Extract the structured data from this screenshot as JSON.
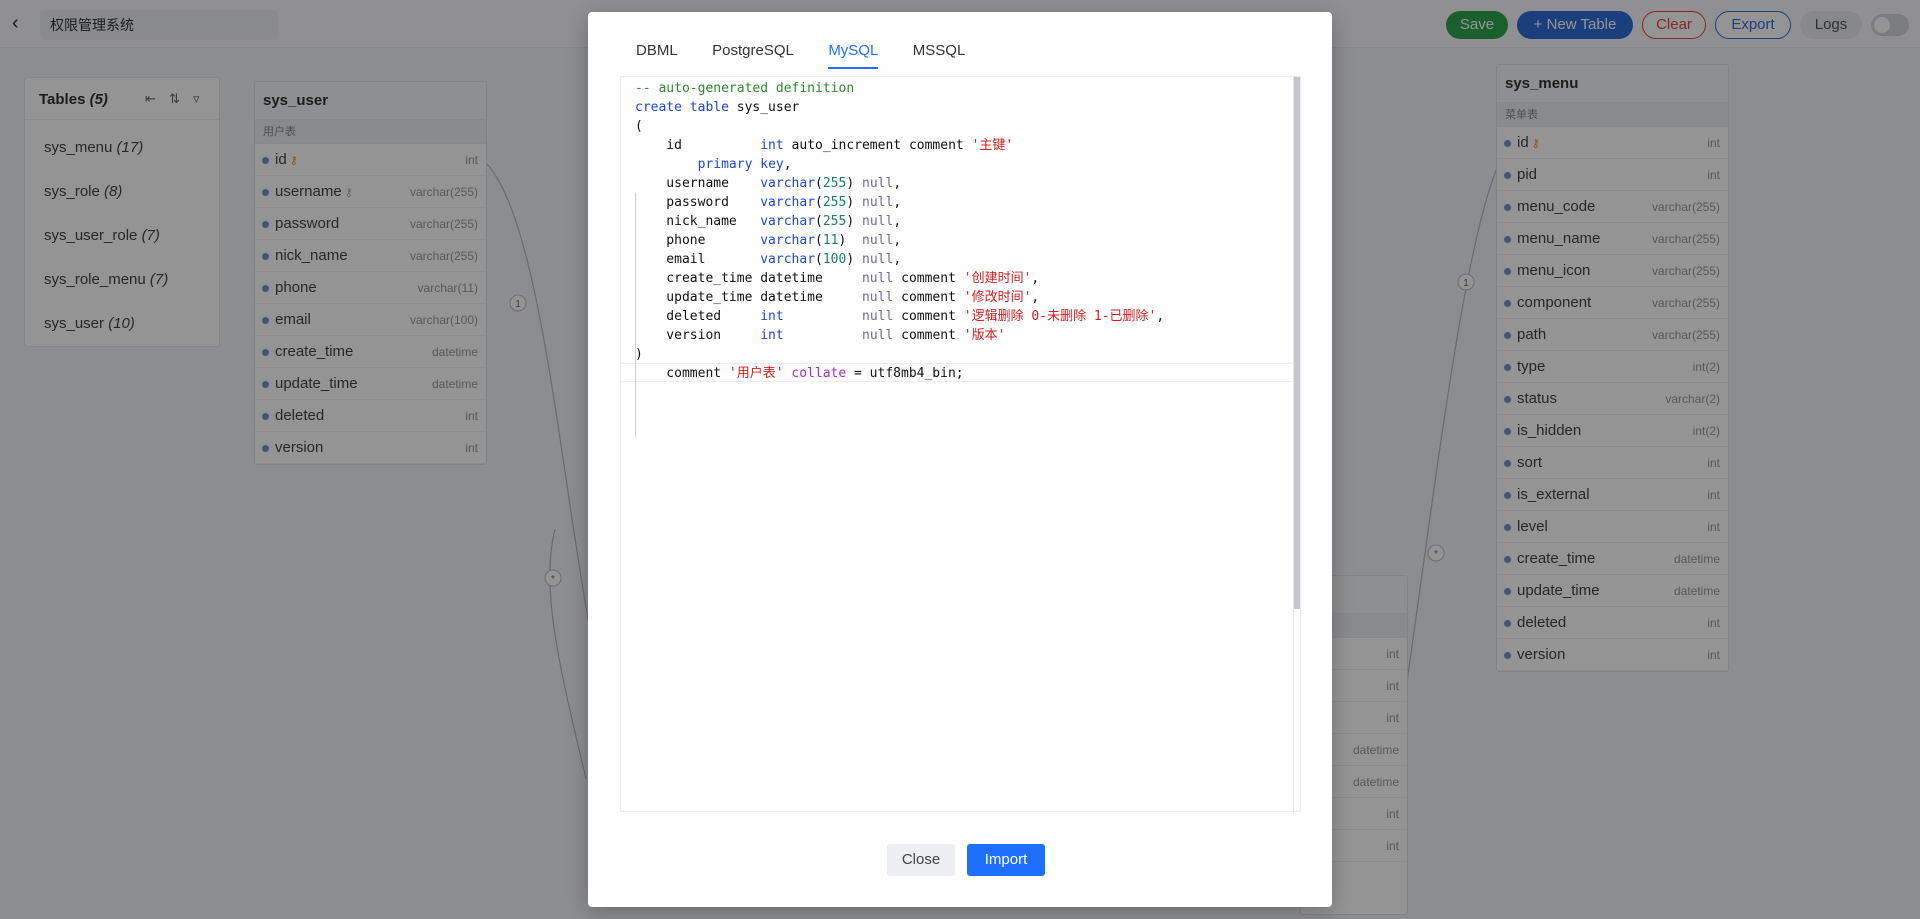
{
  "header": {
    "back_icon": "chevron-left-icon",
    "project_title": "权限管理系统",
    "save": "Save",
    "new_table": "+ New Table",
    "clear": "Clear",
    "export": "Export",
    "logs": "Logs",
    "toggle_on": false
  },
  "tables_panel": {
    "title": "Tables",
    "count": "(5)",
    "items": [
      {
        "name": "sys_menu",
        "count": "(17)"
      },
      {
        "name": "sys_role",
        "count": "(8)"
      },
      {
        "name": "sys_user_role",
        "count": "(7)"
      },
      {
        "name": "sys_role_menu",
        "count": "(7)"
      },
      {
        "name": "sys_user",
        "count": "(10)"
      }
    ]
  },
  "sys_user": {
    "name": "sys_user",
    "comment": "用户表",
    "fields": [
      {
        "name": "id",
        "type": "int",
        "key": "primary"
      },
      {
        "name": "username",
        "type": "varchar(255)",
        "key": "unique"
      },
      {
        "name": "password",
        "type": "varchar(255)"
      },
      {
        "name": "nick_name",
        "type": "varchar(255)"
      },
      {
        "name": "phone",
        "type": "varchar(11)"
      },
      {
        "name": "email",
        "type": "varchar(100)"
      },
      {
        "name": "create_time",
        "type": "datetime"
      },
      {
        "name": "update_time",
        "type": "datetime"
      },
      {
        "name": "deleted",
        "type": "int"
      },
      {
        "name": "version",
        "type": "int"
      }
    ]
  },
  "sys_menu": {
    "name": "sys_menu",
    "comment": "菜单表",
    "fields": [
      {
        "name": "id",
        "type": "int",
        "key": "primary"
      },
      {
        "name": "pid",
        "type": "int"
      },
      {
        "name": "menu_code",
        "type": "varchar(255)"
      },
      {
        "name": "menu_name",
        "type": "varchar(255)"
      },
      {
        "name": "menu_icon",
        "type": "varchar(255)"
      },
      {
        "name": "component",
        "type": "varchar(255)"
      },
      {
        "name": "path",
        "type": "varchar(255)"
      },
      {
        "name": "type",
        "type": "int(2)"
      },
      {
        "name": "status",
        "type": "varchar(2)"
      },
      {
        "name": "is_hidden",
        "type": "int(2)"
      },
      {
        "name": "sort",
        "type": "int"
      },
      {
        "name": "is_external",
        "type": "int"
      },
      {
        "name": "level",
        "type": "int"
      },
      {
        "name": "create_time",
        "type": "datetime"
      },
      {
        "name": "update_time",
        "type": "datetime"
      },
      {
        "name": "deleted",
        "type": "int"
      },
      {
        "name": "version",
        "type": "int"
      }
    ]
  },
  "partial_table": {
    "types": [
      "int",
      "int",
      "int",
      "datetime",
      "datetime",
      "int",
      "int"
    ]
  },
  "relation_labels": {
    "one": "1",
    "many": "*"
  },
  "modal": {
    "tabs": [
      "DBML",
      "PostgreSQL",
      "MySQL",
      "MSSQL"
    ],
    "active_tab": "MySQL",
    "code_lines": [
      [
        [
          "cm",
          "-- auto-generated definition"
        ]
      ],
      [
        [
          "kw",
          "create table "
        ],
        [
          "",
          "sys_user"
        ]
      ],
      [
        [
          "",
          "("
        ]
      ],
      [
        [
          "",
          "    id          "
        ],
        [
          "kw",
          "int"
        ],
        [
          "",
          " auto_increment comment "
        ],
        [
          "str",
          "'主键'"
        ]
      ],
      [
        [
          "",
          "        "
        ],
        [
          "kw",
          "primary key"
        ],
        [
          "",
          ","
        ]
      ],
      [
        [
          "",
          "    username    "
        ],
        [
          "kw",
          "varchar"
        ],
        [
          "",
          "("
        ],
        [
          "num",
          "255"
        ],
        [
          "",
          ") "
        ],
        [
          "null",
          "null"
        ],
        [
          "",
          ","
        ]
      ],
      [
        [
          "",
          "    password    "
        ],
        [
          "kw",
          "varchar"
        ],
        [
          "",
          "("
        ],
        [
          "num",
          "255"
        ],
        [
          "",
          ") "
        ],
        [
          "null",
          "null"
        ],
        [
          "",
          ","
        ]
      ],
      [
        [
          "",
          "    nick_name   "
        ],
        [
          "kw",
          "varchar"
        ],
        [
          "",
          "("
        ],
        [
          "num",
          "255"
        ],
        [
          "",
          ") "
        ],
        [
          "null",
          "null"
        ],
        [
          "",
          ","
        ]
      ],
      [
        [
          "",
          "    phone       "
        ],
        [
          "kw",
          "varchar"
        ],
        [
          "",
          "("
        ],
        [
          "num",
          "11"
        ],
        [
          "",
          ")  "
        ],
        [
          "null",
          "null"
        ],
        [
          "",
          ","
        ]
      ],
      [
        [
          "",
          "    email       "
        ],
        [
          "kw",
          "varchar"
        ],
        [
          "",
          "("
        ],
        [
          "num",
          "100"
        ],
        [
          "",
          ") "
        ],
        [
          "null",
          "null"
        ],
        [
          "",
          ","
        ]
      ],
      [
        [
          "",
          "    create_time datetime     "
        ],
        [
          "null",
          "null"
        ],
        [
          "",
          " comment "
        ],
        [
          "str",
          "'创建时间'"
        ],
        [
          "",
          ","
        ]
      ],
      [
        [
          "",
          "    update_time datetime     "
        ],
        [
          "null",
          "null"
        ],
        [
          "",
          " comment "
        ],
        [
          "str",
          "'修改时间'"
        ],
        [
          "",
          ","
        ]
      ],
      [
        [
          "",
          "    deleted     "
        ],
        [
          "kw",
          "int"
        ],
        [
          "",
          "          "
        ],
        [
          "null",
          "null"
        ],
        [
          "",
          " comment "
        ],
        [
          "str",
          "'逻辑删除 0-未删除 1-已删除'"
        ],
        [
          "",
          ","
        ]
      ],
      [
        [
          "",
          "    version     "
        ],
        [
          "kw",
          "int"
        ],
        [
          "",
          "          "
        ],
        [
          "null",
          "null"
        ],
        [
          "",
          " comment "
        ],
        [
          "str",
          "'版本'"
        ]
      ],
      [
        [
          "",
          ")"
        ]
      ],
      [
        [
          "",
          "    comment "
        ],
        [
          "str",
          "'用户表'"
        ],
        [
          "",
          " "
        ],
        [
          "mag",
          "collate"
        ],
        [
          "",
          " = utf8mb4_bin;"
        ]
      ]
    ],
    "close": "Close",
    "import": "Import"
  }
}
